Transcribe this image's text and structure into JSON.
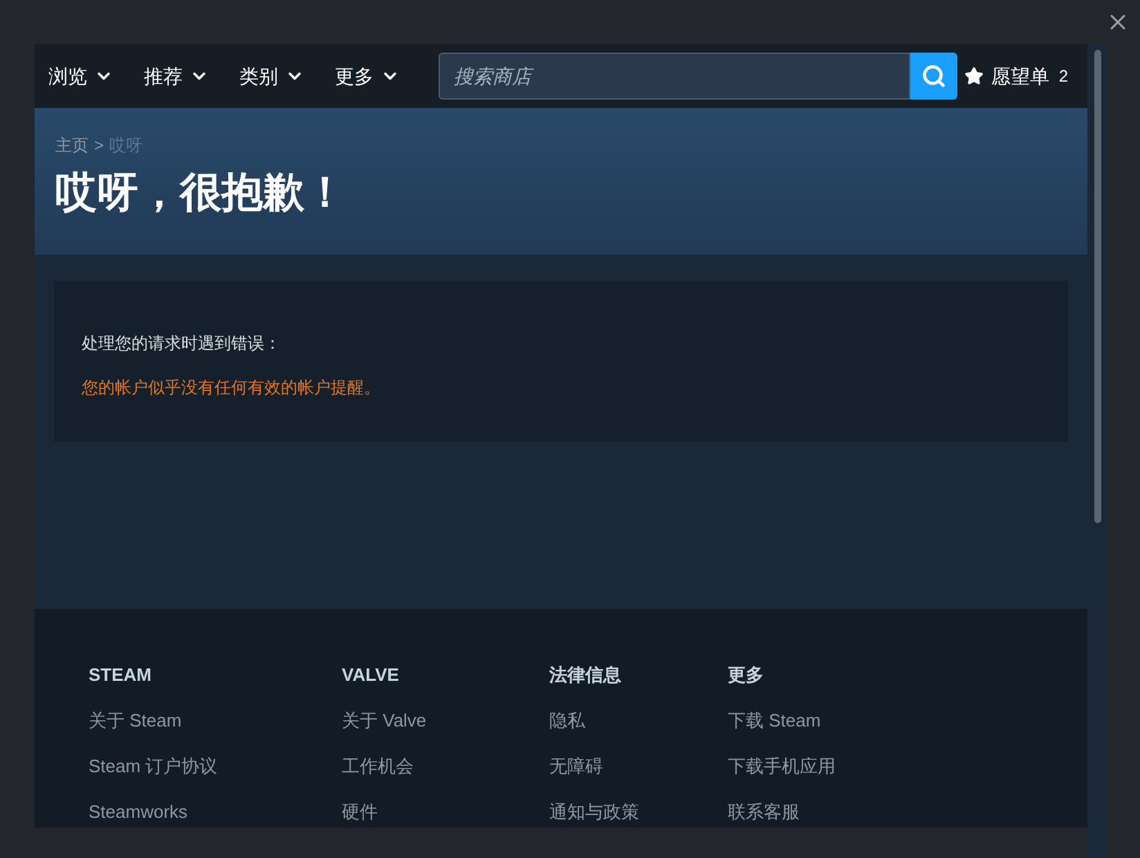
{
  "nav": {
    "menus": [
      {
        "label": "浏览"
      },
      {
        "label": "推荐"
      },
      {
        "label": "类别"
      },
      {
        "label": "更多"
      }
    ],
    "search": {
      "placeholder": "搜索商店"
    },
    "wishlist": {
      "label": "愿望单",
      "count": "2"
    }
  },
  "breadcrumb": [
    {
      "label": "主页"
    },
    {
      "label": "哎呀"
    }
  ],
  "breadcrumb_separator": ">",
  "title": "哎呀，很抱歉！",
  "error": {
    "heading": "处理您的请求时遇到错误：",
    "message": "您的帐户似乎没有任何有效的帐户提醒。"
  },
  "footer": {
    "columns": [
      {
        "heading": "STEAM",
        "links": [
          "关于 Steam",
          "Steam 订户协议",
          "Steamworks"
        ]
      },
      {
        "heading": "VALVE",
        "links": [
          "关于 Valve",
          "工作机会",
          "硬件"
        ]
      },
      {
        "heading": "法律信息",
        "links": [
          "隐私",
          "无障碍",
          "通知与政策"
        ]
      },
      {
        "heading": "更多",
        "links": [
          "下载 Steam",
          "下载手机应用",
          "联系客服"
        ]
      }
    ]
  }
}
